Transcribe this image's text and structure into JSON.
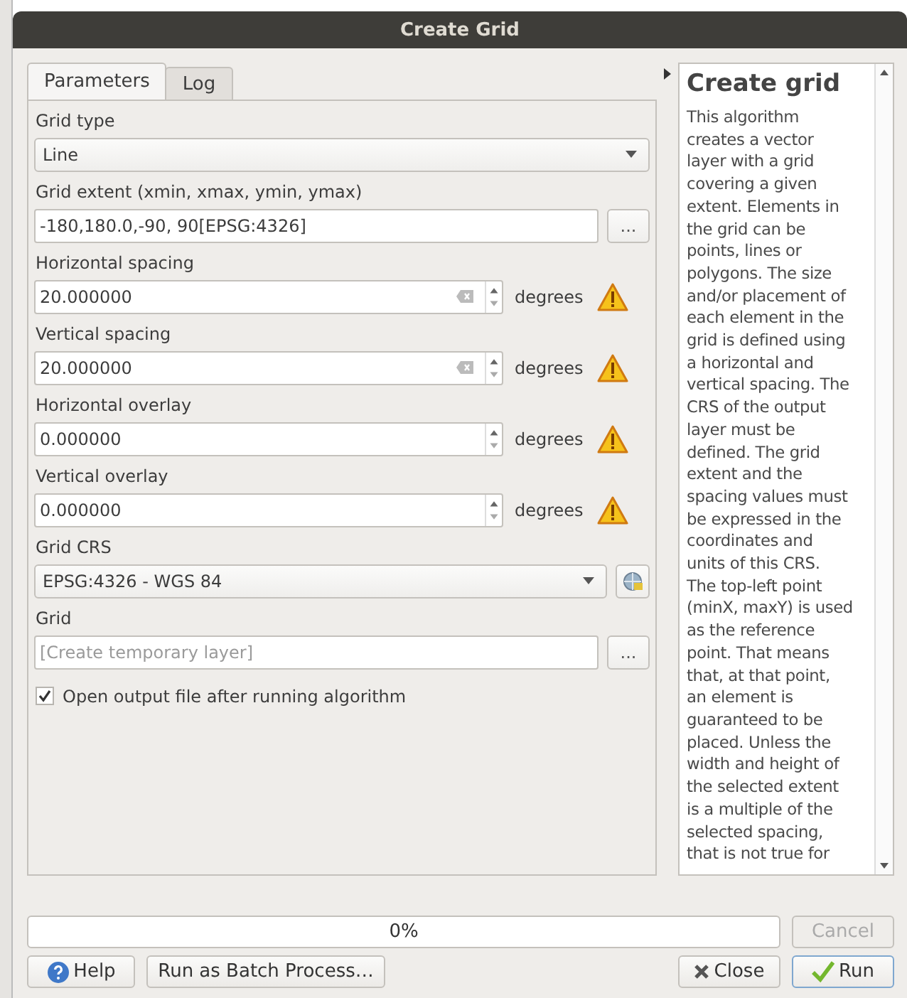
{
  "window": {
    "title": "Create Grid"
  },
  "tabs": [
    {
      "label": "Parameters",
      "selected": true
    },
    {
      "label": "Log",
      "selected": false
    }
  ],
  "parameters": [
    {
      "kind": "select",
      "label": "Grid type",
      "value": "Line"
    },
    {
      "kind": "extent",
      "label": "Grid extent (xmin, xmax, ymin, ymax)",
      "value": "-180,180.0,-90, 90[EPSG:4326]",
      "button": "..."
    },
    {
      "kind": "spin",
      "label": "Horizontal spacing",
      "value": "20.000000",
      "clearable": true,
      "unit": "degrees",
      "warning": true
    },
    {
      "kind": "spin",
      "label": "Vertical spacing",
      "value": "20.000000",
      "clearable": true,
      "unit": "degrees",
      "warning": true
    },
    {
      "kind": "spin",
      "label": "Horizontal overlay",
      "value": "0.000000",
      "clearable": false,
      "unit": "degrees",
      "warning": true
    },
    {
      "kind": "spin",
      "label": "Vertical overlay",
      "value": "0.000000",
      "clearable": false,
      "unit": "degrees",
      "warning": true
    },
    {
      "kind": "crs",
      "label": "Grid CRS",
      "value": "EPSG:4326 - WGS 84"
    },
    {
      "kind": "output",
      "label": "Grid",
      "placeholder": "[Create temporary layer]",
      "button": "..."
    },
    {
      "kind": "checkbox",
      "label": "Open output file after running algorithm",
      "checked": true
    }
  ],
  "help": {
    "title": "Create grid",
    "lines": [
      "This algorithm",
      "creates a vector",
      "layer with a grid",
      "covering a given",
      "extent. Elements in",
      "the grid can be",
      "points, lines or",
      "polygons. The size",
      "and/or placement of",
      "each element in the",
      "grid is defined using",
      "a horizontal and",
      "vertical spacing. The",
      "CRS of the output",
      "layer must be",
      "defined. The grid",
      "extent and the",
      "spacing values must",
      "be expressed in the",
      "coordinates and",
      "units of this CRS.",
      "The top-left point",
      "(minX, maxY) is used",
      "as the reference",
      "point. That means",
      "that, at that point,",
      "an element is",
      "guaranteed to be",
      "placed. Unless the",
      "width and height of",
      "the selected extent",
      "is a multiple of the",
      "selected spacing,",
      "that is not true for"
    ]
  },
  "progress": {
    "level": 0,
    "text": "0%"
  },
  "buttons": [
    {
      "kind": "cancel",
      "label": "Cancel",
      "disabled": true
    },
    {
      "kind": "help",
      "label": "Help",
      "disabled": false
    },
    {
      "kind": "batch",
      "label": "Run as Batch Process…",
      "disabled": false
    },
    {
      "kind": "close",
      "label": "Close",
      "disabled": false
    },
    {
      "kind": "run",
      "label": "Run",
      "disabled": false
    }
  ]
}
